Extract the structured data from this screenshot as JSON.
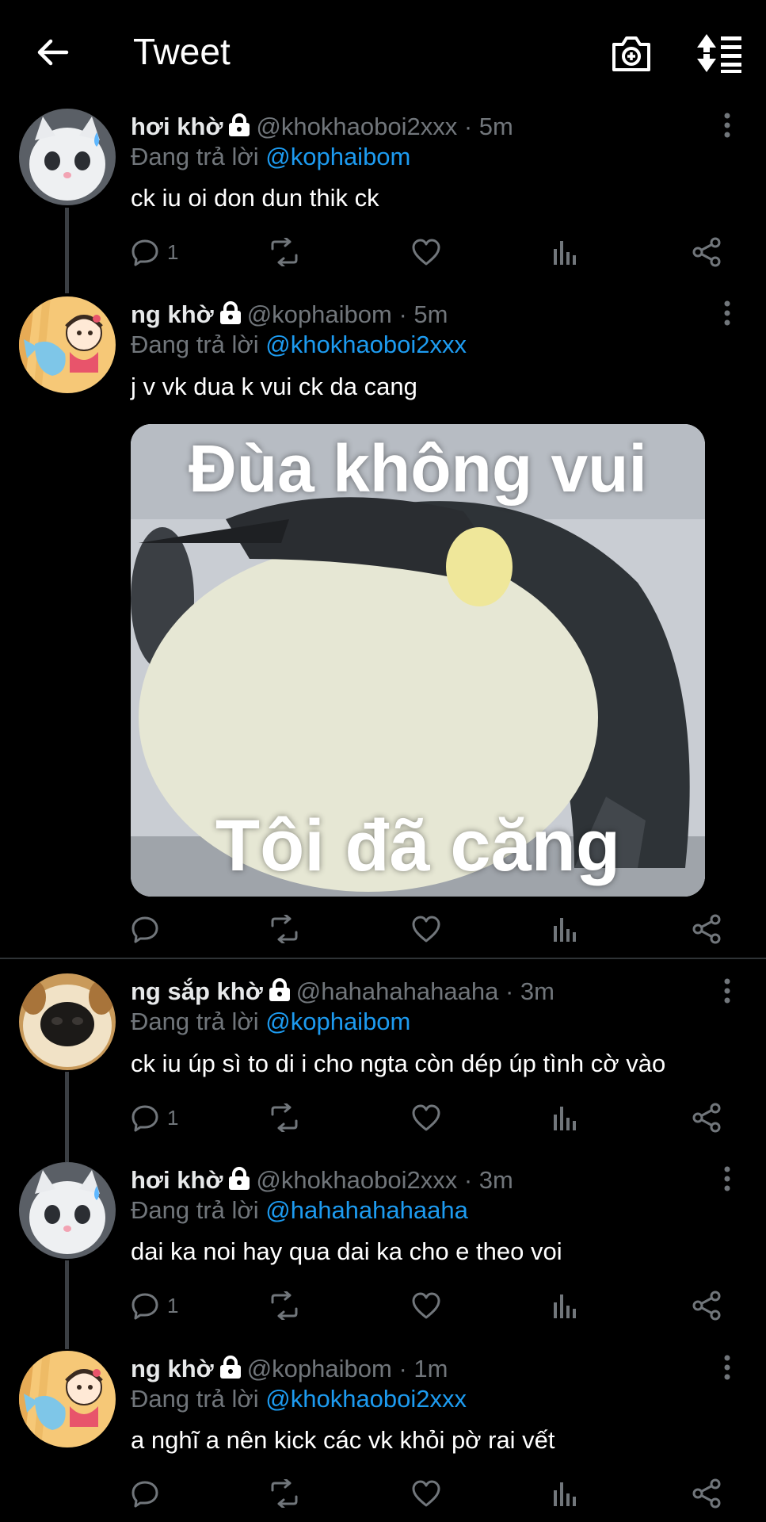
{
  "header": {
    "title": "Tweet"
  },
  "tweets": [
    {
      "name": "hơi khờ",
      "handle": "@khokhaoboi2xxx",
      "time": "· 5m",
      "reply_prefix": "Đang trả lời",
      "reply_to": "@kophaibom",
      "text": "ck iu oi don dun thik ck",
      "reply_count": "1"
    },
    {
      "name": "ng khờ",
      "handle": "@kophaibom",
      "time": "· 5m",
      "reply_prefix": "Đang trả lời",
      "reply_to": "@khokhaoboi2xxx",
      "text": "j v vk dua k vui ck da cang",
      "image_caption_top": "Đùa không vui",
      "image_caption_bottom": "Tôi đã căng"
    },
    {
      "name": "ng sắp khờ",
      "handle": "@hahahahahaaha",
      "time": "· 3m",
      "reply_prefix": "Đang trả lời",
      "reply_to": "@kophaibom",
      "text": "ck iu úp sì to di i cho ngta còn dép úp tình cờ vào",
      "reply_count": "1"
    },
    {
      "name": "hơi khờ",
      "handle": "@khokhaoboi2xxx",
      "time": "· 3m",
      "reply_prefix": "Đang trả lời",
      "reply_to": "@hahahahahaaha",
      "text": "dai ka noi hay qua dai ka cho e theo voi",
      "reply_count": "1"
    },
    {
      "name": "ng khờ",
      "handle": "@kophaibom",
      "time": "· 1m",
      "reply_prefix": "Đang trả lời",
      "reply_to": "@khokhaoboi2xxx",
      "text": "a nghĩ a nên kick các vk khỏi pờ rai vết"
    }
  ],
  "colors": {
    "background": "#000000",
    "text": "#e7e9ea",
    "muted": "#71767b",
    "link": "#1d9bf0",
    "divider": "#2f3336"
  },
  "icons": [
    "back-arrow-icon",
    "camera-plus-icon",
    "sort-icon",
    "lock-icon",
    "more-vertical-icon",
    "reply-icon",
    "retweet-icon",
    "like-icon",
    "analytics-icon",
    "share-icon"
  ]
}
